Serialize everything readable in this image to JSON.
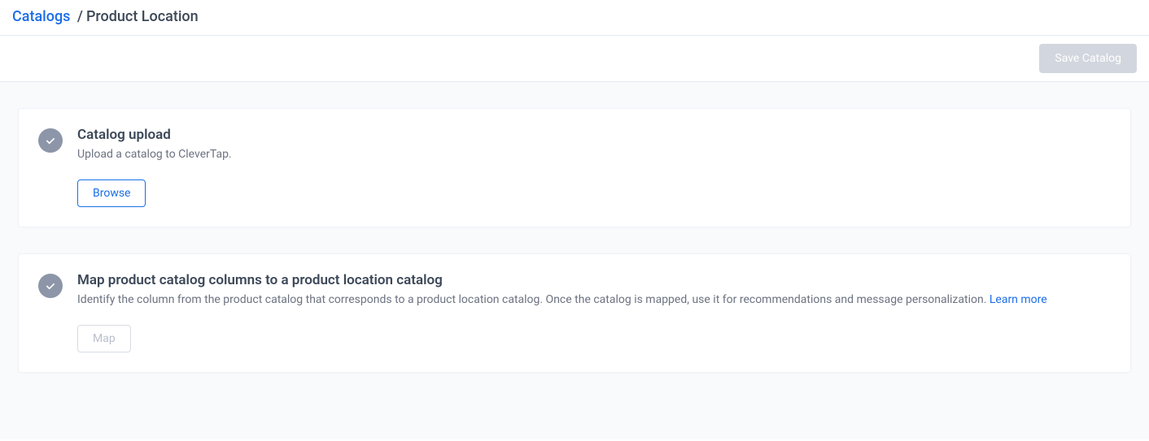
{
  "breadcrumb": {
    "root": "Catalogs",
    "separator": "/",
    "current": "Product Location"
  },
  "toolbar": {
    "save_label": "Save Catalog"
  },
  "cards": {
    "upload": {
      "title": "Catalog upload",
      "desc": "Upload a catalog to CleverTap.",
      "action_label": "Browse"
    },
    "map": {
      "title": "Map product catalog columns to a product location catalog",
      "desc_prefix": "Identify the column from the product catalog that corresponds to a product location catalog. Once the catalog is mapped, use it for recommendations and message personalization. ",
      "learn_more": "Learn more",
      "action_label": "Map"
    }
  }
}
